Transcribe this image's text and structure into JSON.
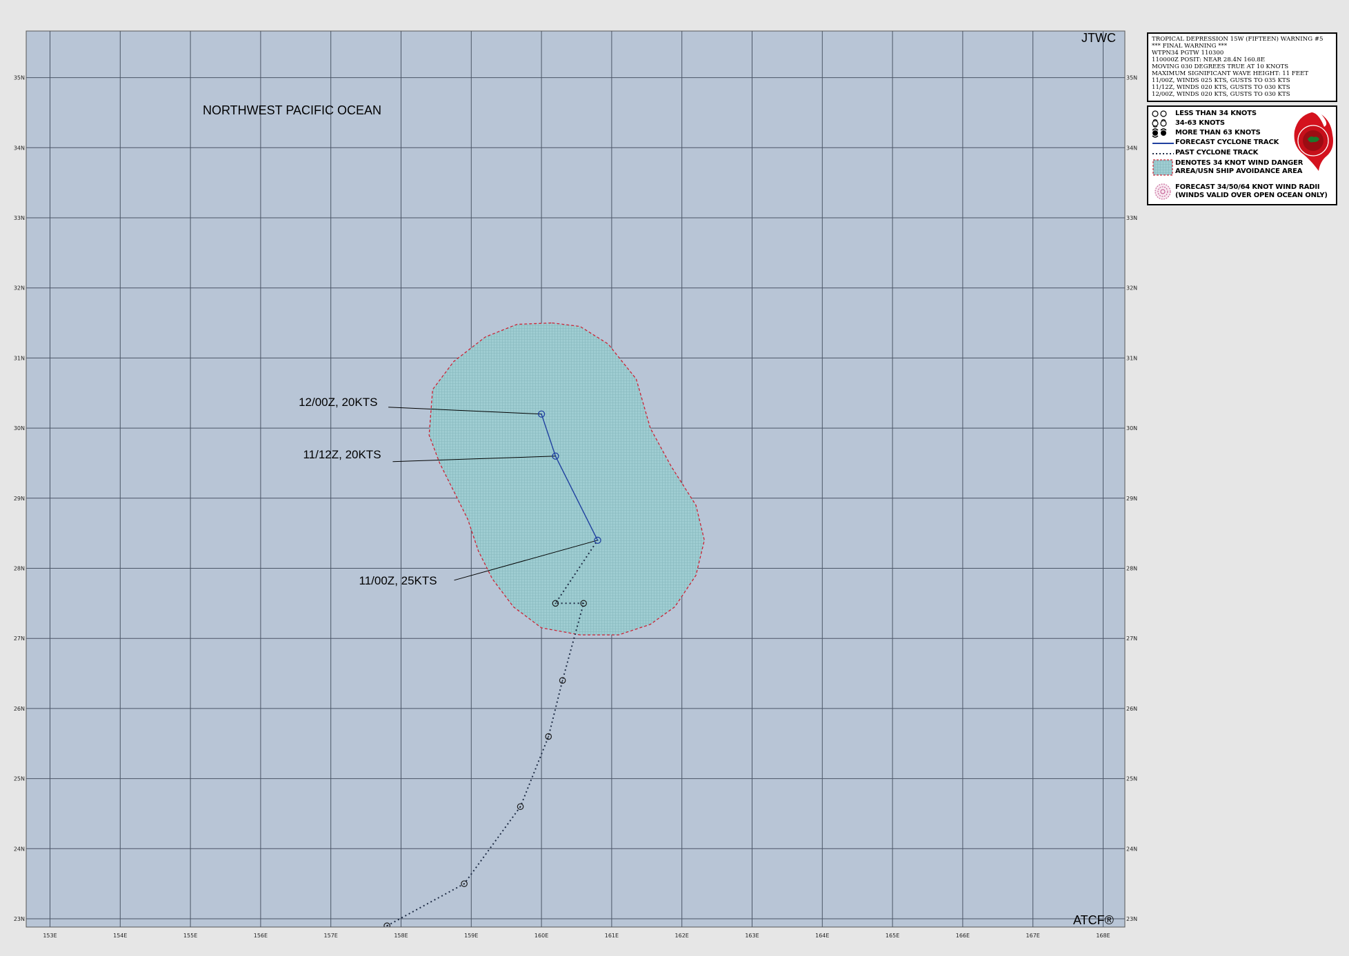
{
  "map": {
    "region_label": "NORTHWEST PACIFIC OCEAN",
    "top_right_label": "JTWC",
    "bottom_right_label": "ATCF®",
    "lon_labels": [
      "153E",
      "154E",
      "155E",
      "156E",
      "157E",
      "158E",
      "159E",
      "160E",
      "161E",
      "162E",
      "163E",
      "164E",
      "165E",
      "166E",
      "167E",
      "168E"
    ],
    "lat_labels": [
      "23N",
      "24N",
      "25N",
      "26N",
      "27N",
      "28N",
      "29N",
      "30N",
      "31N",
      "32N",
      "33N",
      "34N",
      "35N"
    ],
    "colors": {
      "ocean": "#b8c5d6",
      "grid": "#4a5566",
      "danger_fill": "#99c9cf",
      "danger_border": "#cc2233",
      "forecast_track": "#1f3f9f",
      "past_track": "#1d2b44"
    }
  },
  "storm": {
    "forecast_points": [
      {
        "lon": 160.8,
        "lat": 28.4,
        "label": "11/00Z,  25KTS"
      },
      {
        "lon": 160.2,
        "lat": 29.6,
        "label": "11/12Z,  20KTS"
      },
      {
        "lon": 160.0,
        "lat": 30.2,
        "label": "12/00Z,  20KTS"
      }
    ],
    "past_track": [
      {
        "lon": 157.8,
        "lat": 22.9
      },
      {
        "lon": 158.9,
        "lat": 23.5
      },
      {
        "lon": 159.7,
        "lat": 24.6
      },
      {
        "lon": 160.1,
        "lat": 25.6
      },
      {
        "lon": 160.3,
        "lat": 26.4
      },
      {
        "lon": 160.6,
        "lat": 27.5
      },
      {
        "lon": 160.2,
        "lat": 27.5
      },
      {
        "lon": 160.8,
        "lat": 28.4
      }
    ],
    "danger_area": [
      [
        160.15,
        31.5
      ],
      [
        160.55,
        31.45
      ],
      [
        160.95,
        31.2
      ],
      [
        161.35,
        30.7
      ],
      [
        161.55,
        30.0
      ],
      [
        161.85,
        29.45
      ],
      [
        162.2,
        28.9
      ],
      [
        162.32,
        28.4
      ],
      [
        162.2,
        27.9
      ],
      [
        161.9,
        27.45
      ],
      [
        161.55,
        27.2
      ],
      [
        161.1,
        27.05
      ],
      [
        160.55,
        27.05
      ],
      [
        160.0,
        27.15
      ],
      [
        159.6,
        27.45
      ],
      [
        159.3,
        27.85
      ],
      [
        159.1,
        28.25
      ],
      [
        158.95,
        28.7
      ],
      [
        158.75,
        29.1
      ],
      [
        158.55,
        29.5
      ],
      [
        158.4,
        29.9
      ],
      [
        158.45,
        30.55
      ],
      [
        158.75,
        30.95
      ],
      [
        159.2,
        31.3
      ],
      [
        159.65,
        31.48
      ]
    ]
  },
  "warning": {
    "lines": [
      "TROPICAL DEPRESSION 15W (FIFTEEN) WARNING #5",
      "*** FINAL WARNING ***",
      "WTPN34 PGTW 110300",
      "110000Z POSIT: NEAR 28.4N 160.8E",
      "MOVING 030 DEGREES TRUE AT 10 KNOTS",
      "MAXIMUM SIGNIFICANT WAVE HEIGHT: 11 FEET",
      "11/00Z, WINDS 025 KTS, GUSTS TO 035 KTS",
      "11/12Z, WINDS 020 KTS, GUSTS TO 030 KTS",
      "12/00Z, WINDS 020 KTS, GUSTS TO 030 KTS"
    ]
  },
  "legend": {
    "less_than_34": "LESS THAN 34 KNOTS",
    "k34_63": "34-63 KNOTS",
    "more_than_63": "MORE THAN 63 KNOTS",
    "forecast_track": "FORECAST CYCLONE TRACK",
    "past_track": "PAST CYCLONE TRACK",
    "danger_area_line1": "DENOTES 34 KNOT WIND DANGER",
    "danger_area_line2": "AREA/USN SHIP AVOIDANCE AREA",
    "wind_radii_line1": "FORECAST 34/50/64 KNOT WIND RADII",
    "wind_radii_line2": "(WINDS VALID OVER OPEN OCEAN ONLY)",
    "seal_color": "#d4121e"
  }
}
